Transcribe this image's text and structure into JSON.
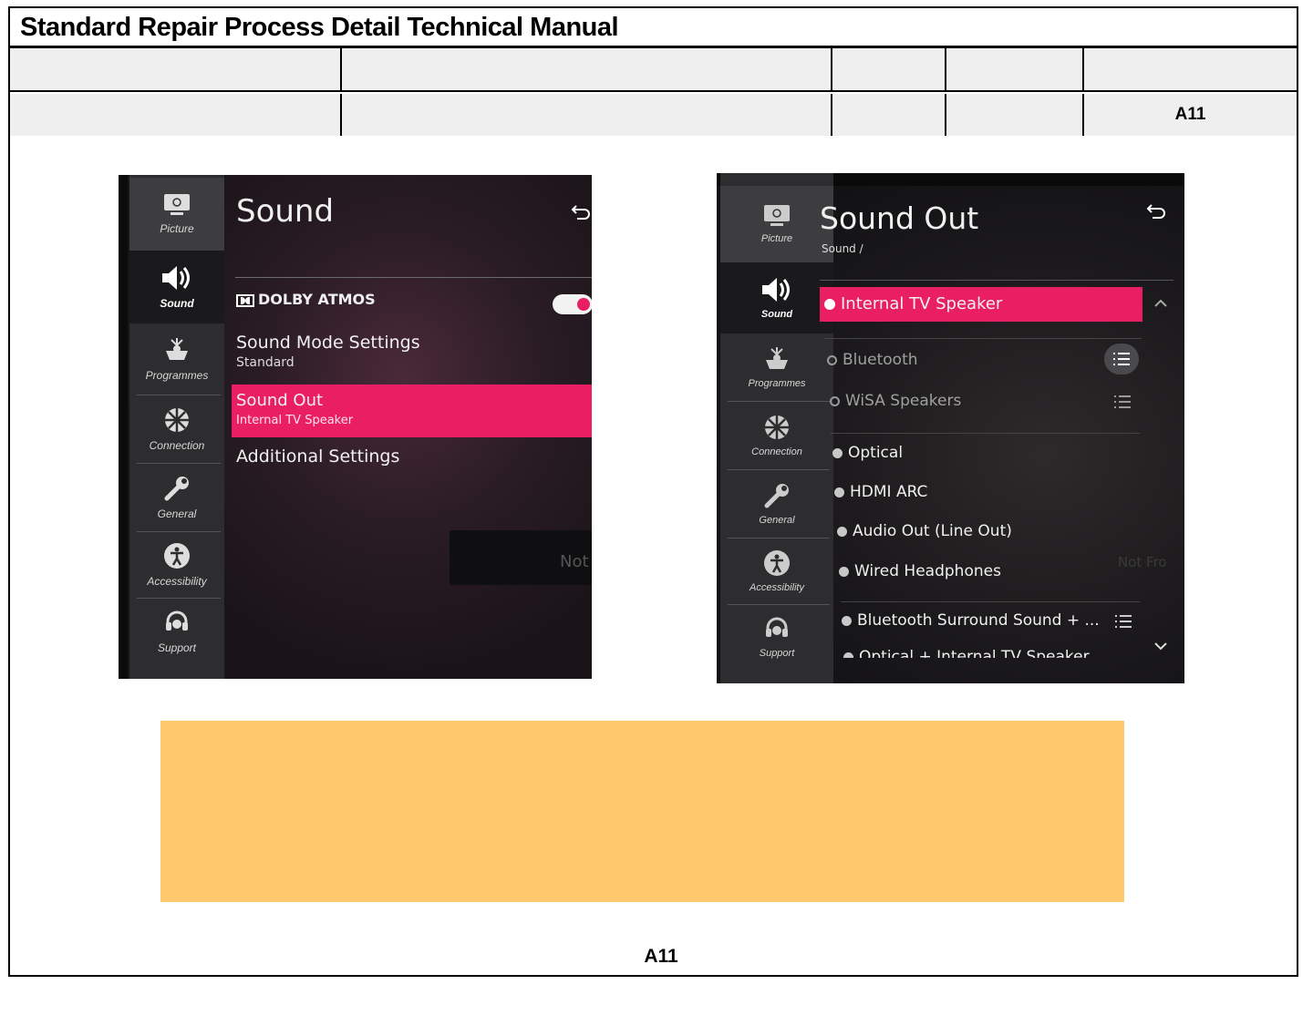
{
  "document": {
    "title": "Standard Repair Process Detail Technical Manual",
    "header_code": "A11",
    "footer_code": "A11"
  },
  "tv_menu": {
    "sidebar": [
      {
        "label": "Picture",
        "icon": "picture-icon"
      },
      {
        "label": "Sound",
        "icon": "speaker-icon"
      },
      {
        "label": "Programmes",
        "icon": "antenna-icon"
      },
      {
        "label": "Connection",
        "icon": "connection-icon"
      },
      {
        "label": "General",
        "icon": "wrench-icon"
      },
      {
        "label": "Accessibility",
        "icon": "accessibility-icon"
      },
      {
        "label": "Support",
        "icon": "headset-icon"
      }
    ]
  },
  "screen_sound": {
    "title": "Sound",
    "dolby_label": "DOLBY ATMOS",
    "dolby_enabled": true,
    "items": [
      {
        "label": "Sound Mode Settings",
        "value": "Standard"
      },
      {
        "label": "Sound Out",
        "value": "Internal TV Speaker",
        "selected": true
      },
      {
        "label": "Additional Settings",
        "value": ""
      }
    ],
    "bg_text": "Not"
  },
  "screen_sound_out": {
    "title": "Sound Out",
    "breadcrumb": "Sound /",
    "selected": "Internal TV Speaker",
    "options": [
      {
        "label": "Bluetooth",
        "has_list": true
      },
      {
        "label": "WiSA Speakers",
        "has_list": true
      },
      {
        "label": "Optical",
        "has_list": false
      },
      {
        "label": "HDMI ARC",
        "has_list": false
      },
      {
        "label": "Audio Out (Line Out)",
        "has_list": false
      },
      {
        "label": "Wired Headphones",
        "has_list": false
      },
      {
        "label": "Bluetooth Surround Sound + ...",
        "has_list": true
      },
      {
        "label": "Optical + Internal TV Speaker",
        "has_list": false
      }
    ],
    "bg_text": "Not Fro"
  },
  "colors": {
    "accent_pink": "#ea1e63",
    "note_box": "#fdc96c",
    "header_fill": "#efefef"
  }
}
